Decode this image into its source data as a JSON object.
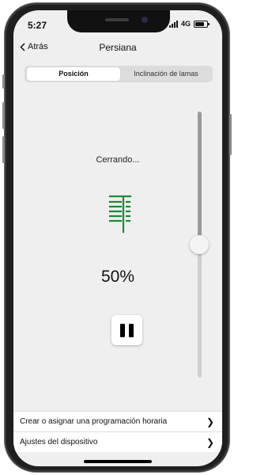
{
  "status_bar": {
    "time": "5:27",
    "network": "4G"
  },
  "nav": {
    "back_label": "Atrás",
    "title": "Persiana"
  },
  "tabs": [
    {
      "label": "Posición",
      "active": true
    },
    {
      "label": "Inclinación de lamas",
      "active": false
    }
  ],
  "control": {
    "status_text": "Cerrando...",
    "icon": "blind-closing-icon",
    "position_label": "50%",
    "position_value": 0.5,
    "pause_icon": "pause-icon"
  },
  "settings_list": [
    {
      "label": "Crear o asignar una programación horaria"
    },
    {
      "label": "Ajustes del dispositivo"
    }
  ],
  "colors": {
    "accent_green": "#1b8a3a",
    "background": "#efefef"
  }
}
